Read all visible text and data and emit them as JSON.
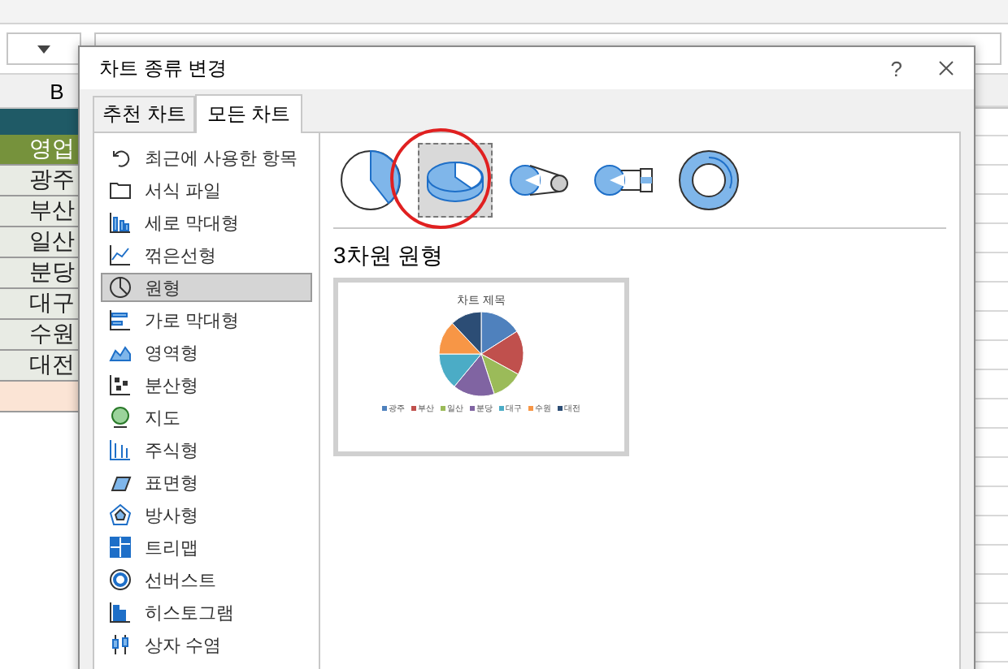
{
  "sheet": {
    "column_header": "B",
    "header_cell": "영업",
    "rows": [
      "광주",
      "부산",
      "일산",
      "분당",
      "대구",
      "수원",
      "대전"
    ]
  },
  "dialog": {
    "title": "차트 종류 변경",
    "help": "?",
    "tabs": [
      {
        "label": "추천 차트",
        "selected": false
      },
      {
        "label": "모든 차트",
        "selected": true
      }
    ],
    "chart_types": [
      {
        "kind": "recent",
        "label": "최근에 사용한 항목",
        "selected": false
      },
      {
        "kind": "template",
        "label": "서식 파일",
        "selected": false
      },
      {
        "kind": "column",
        "label": "세로 막대형",
        "selected": false
      },
      {
        "kind": "line",
        "label": "꺾은선형",
        "selected": false
      },
      {
        "kind": "pie",
        "label": "원형",
        "selected": true
      },
      {
        "kind": "bar",
        "label": "가로 막대형",
        "selected": false
      },
      {
        "kind": "area",
        "label": "영역형",
        "selected": false
      },
      {
        "kind": "scatter",
        "label": "분산형",
        "selected": false
      },
      {
        "kind": "map",
        "label": "지도",
        "selected": false
      },
      {
        "kind": "stock",
        "label": "주식형",
        "selected": false
      },
      {
        "kind": "surface",
        "label": "표면형",
        "selected": false
      },
      {
        "kind": "radar",
        "label": "방사형",
        "selected": false
      },
      {
        "kind": "treemap",
        "label": "트리맵",
        "selected": false
      },
      {
        "kind": "sunburst",
        "label": "선버스트",
        "selected": false
      },
      {
        "kind": "histogram",
        "label": "히스토그램",
        "selected": false
      },
      {
        "kind": "box",
        "label": "상자 수염",
        "selected": false
      }
    ],
    "subtypes": [
      {
        "kind": "pie",
        "selected": false
      },
      {
        "kind": "pie3d",
        "selected": true
      },
      {
        "kind": "pie_of_pie",
        "selected": false
      },
      {
        "kind": "bar_of_pie",
        "selected": false
      },
      {
        "kind": "doughnut",
        "selected": false
      }
    ],
    "subtype_title": "3차원 원형",
    "preview": {
      "title": "차트 제목",
      "legend": [
        {
          "label": "광주",
          "color": "#4f81bd"
        },
        {
          "label": "부산",
          "color": "#c0504d"
        },
        {
          "label": "일산",
          "color": "#9bbb59"
        },
        {
          "label": "분당",
          "color": "#8064a2"
        },
        {
          "label": "대구",
          "color": "#4bacc6"
        },
        {
          "label": "수원",
          "color": "#f79646"
        },
        {
          "label": "대전",
          "color": "#2c4d75"
        }
      ]
    }
  }
}
